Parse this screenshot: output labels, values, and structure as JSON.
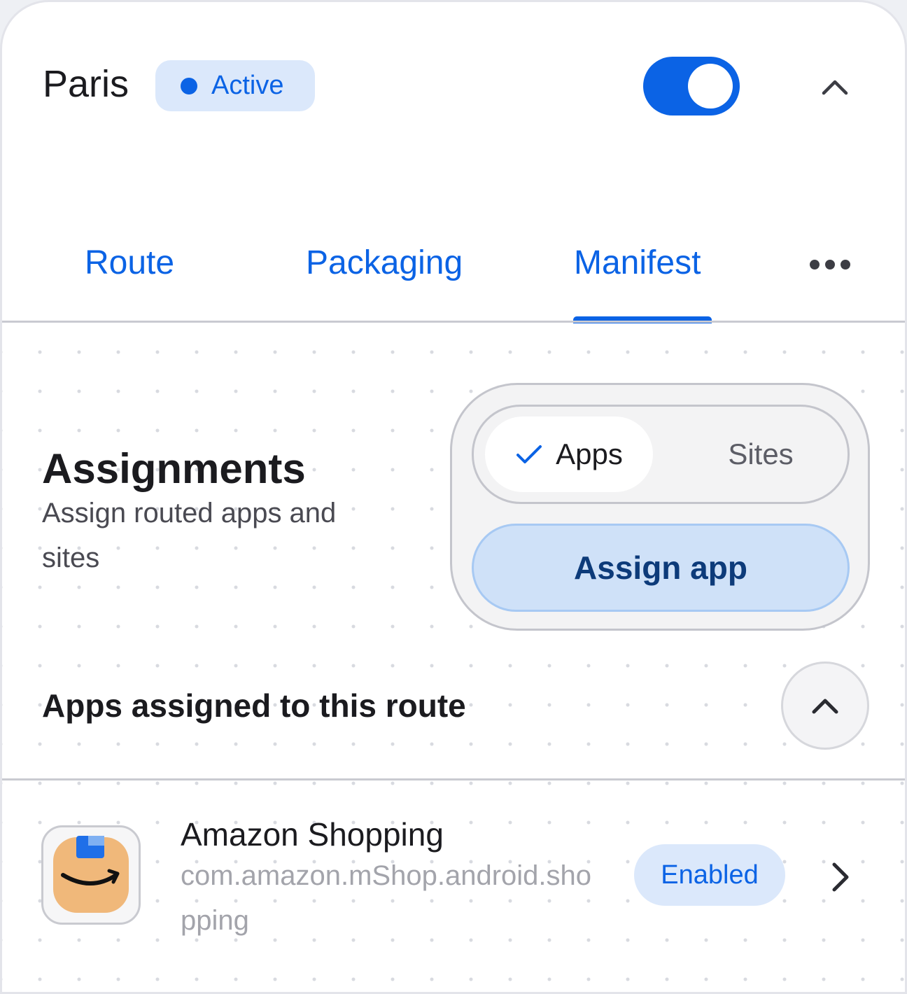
{
  "header": {
    "city": "Paris",
    "status_label": "Active",
    "toggle_state": "on",
    "collapse_icon": "chevron-up-icon"
  },
  "tabs": [
    {
      "label": "Route",
      "selected": false
    },
    {
      "label": "Packaging",
      "selected": false
    },
    {
      "label": "Manifest",
      "selected": true
    }
  ],
  "tabs_more_icon": "more-horizontal-icon",
  "assignments": {
    "title": "Assignments",
    "subtitle": "Assign routed apps and sites",
    "segments": [
      {
        "label": "Apps",
        "selected": true,
        "icon": "check-icon"
      },
      {
        "label": "Sites",
        "selected": false
      }
    ],
    "assign_button": "Assign app"
  },
  "apps_section": {
    "heading": "Apps assigned to this route",
    "collapse_icon": "chevron-up-icon",
    "items": [
      {
        "name": "Amazon Shopping",
        "package": "com.amazon.mShop.android.shopping",
        "status": "Enabled",
        "icon": "amazon-shopping-icon"
      }
    ]
  },
  "colors": {
    "accent": "#0b63e5",
    "chip_bg": "#dbe8fb",
    "button_bg": "#cfe1f8",
    "amazon_orange": "#f0b87a"
  }
}
